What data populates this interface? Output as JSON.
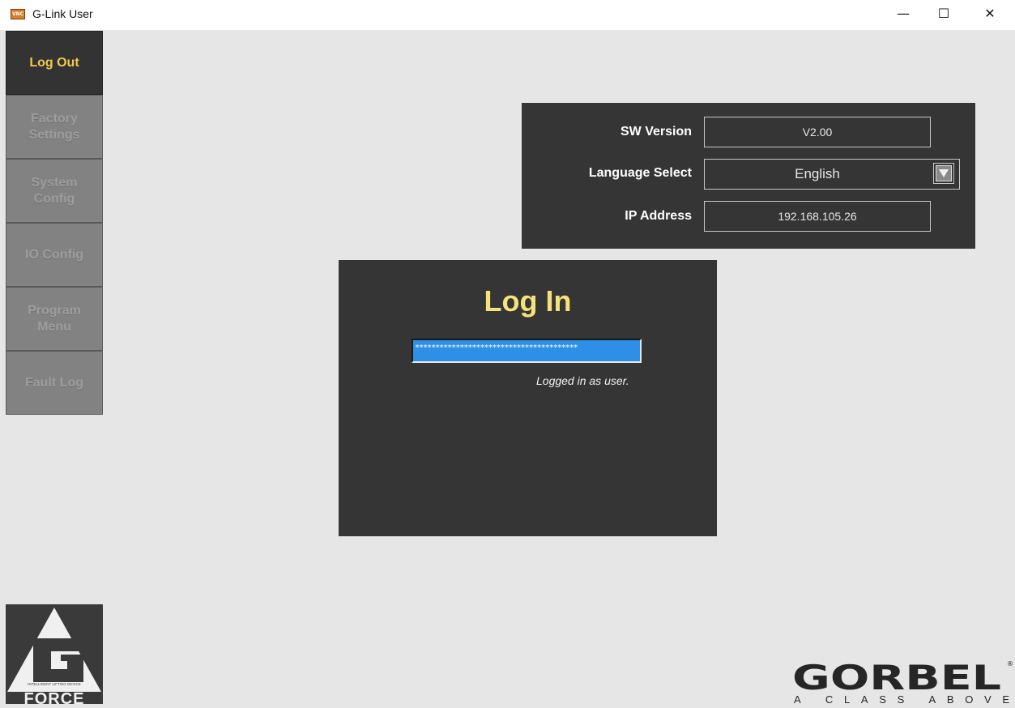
{
  "window": {
    "app_icon_text": "VNC",
    "title": "G-Link User",
    "controls": {
      "minimize": "—",
      "maximize": "☐",
      "close": "✕"
    }
  },
  "sidebar": {
    "items": [
      {
        "label": "Log Out",
        "active": true
      },
      {
        "label": "Factory\nSettings",
        "active": false
      },
      {
        "label": "System\nConfig",
        "active": false
      },
      {
        "label": "IO Config",
        "active": false
      },
      {
        "label": "Program\nMenu",
        "active": false
      },
      {
        "label": "Fault Log",
        "active": false
      }
    ]
  },
  "info": {
    "sw_version_label": "SW Version",
    "sw_version_value": "V2.00",
    "language_label": "Language Select",
    "language_value": "English",
    "ip_label": "IP Address",
    "ip_value": "192.168.105.26"
  },
  "login": {
    "title": "Log In",
    "password_mask": "****************************************",
    "status": "Logged in as user."
  },
  "logos": {
    "gforce_tagline": "INTELLIGENT LIFTING DEVICE",
    "gforce_text": "FORCE",
    "gorbel_name": "GORBEL",
    "gorbel_slogan": "A  CLASS  ABOVE"
  },
  "colors": {
    "accent_gold": "#f2c94c",
    "title_yellow": "#f5e27a",
    "panel_dark": "#353535",
    "field_blue": "#2e8fe6"
  }
}
